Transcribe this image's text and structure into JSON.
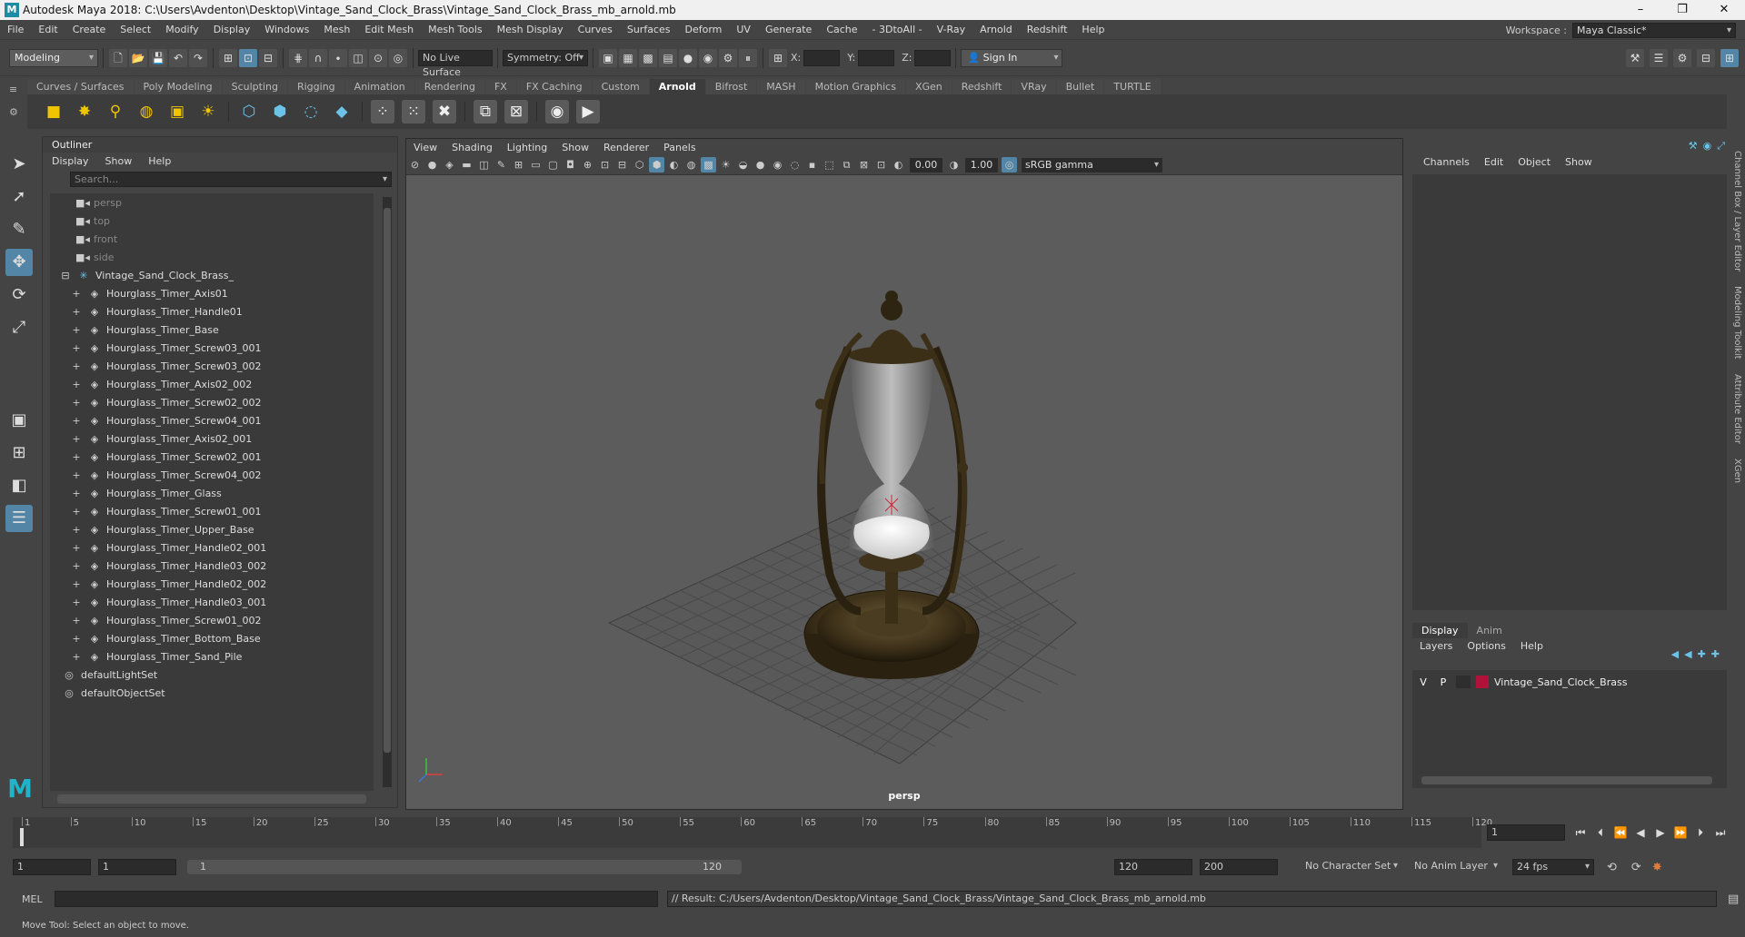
{
  "window": {
    "title": "Autodesk Maya 2018: C:\\Users\\Avdenton\\Desktop\\Vintage_Sand_Clock_Brass\\Vintage_Sand_Clock_Brass_mb_arnold.mb",
    "minimize": "–",
    "maximize": "❐",
    "close": "✕"
  },
  "menubar": {
    "items": [
      "File",
      "Edit",
      "Create",
      "Select",
      "Modify",
      "Display",
      "Windows",
      "Mesh",
      "Edit Mesh",
      "Mesh Tools",
      "Mesh Display",
      "Curves",
      "Surfaces",
      "Deform",
      "UV",
      "Generate",
      "Cache",
      "- 3DtoAll -",
      "V-Ray",
      "Arnold",
      "Redshift",
      "Help"
    ],
    "workspace_label": "Workspace :",
    "workspace_value": "Maya Classic*"
  },
  "statusline": {
    "menuset": "Modeling",
    "live_surface": "No Live Surface",
    "symmetry": "Symmetry: Off",
    "x_label": "X:",
    "y_label": "Y:",
    "z_label": "Z:",
    "sign_in": "Sign In"
  },
  "shelf": {
    "tabs": [
      "Curves / Surfaces",
      "Poly Modeling",
      "Sculpting",
      "Rigging",
      "Animation",
      "Rendering",
      "FX",
      "FX Caching",
      "Custom",
      "Arnold",
      "Bifrost",
      "MASH",
      "Motion Graphics",
      "XGen",
      "Redshift",
      "VRay",
      "Bullet",
      "TURTLE"
    ],
    "active_tab": "Arnold"
  },
  "outliner": {
    "title": "Outliner",
    "menu": [
      "Display",
      "Show",
      "Help"
    ],
    "search_placeholder": "Search...",
    "cameras": [
      "persp",
      "top",
      "front",
      "side"
    ],
    "group": "Vintage_Sand_Clock_Brass_",
    "children": [
      "Hourglass_Timer_Axis01",
      "Hourglass_Timer_Handle01",
      "Hourglass_Timer_Base",
      "Hourglass_Timer_Screw03_001",
      "Hourglass_Timer_Screw03_002",
      "Hourglass_Timer_Axis02_002",
      "Hourglass_Timer_Screw02_002",
      "Hourglass_Timer_Screw04_001",
      "Hourglass_Timer_Axis02_001",
      "Hourglass_Timer_Screw02_001",
      "Hourglass_Timer_Screw04_002",
      "Hourglass_Timer_Glass",
      "Hourglass_Timer_Screw01_001",
      "Hourglass_Timer_Upper_Base",
      "Hourglass_Timer_Handle02_001",
      "Hourglass_Timer_Handle03_002",
      "Hourglass_Timer_Handle02_002",
      "Hourglass_Timer_Handle03_001",
      "Hourglass_Timer_Screw01_002",
      "Hourglass_Timer_Bottom_Base",
      "Hourglass_Timer_Sand_Pile"
    ],
    "sets": [
      "defaultLightSet",
      "defaultObjectSet"
    ]
  },
  "viewport": {
    "menu": [
      "View",
      "Shading",
      "Lighting",
      "Show",
      "Renderer",
      "Panels"
    ],
    "exposure": "0.00",
    "gamma": "1.00",
    "colorspace": "sRGB gamma",
    "camera_label": "persp"
  },
  "channelbox": {
    "menu": [
      "Channels",
      "Edit",
      "Object",
      "Show"
    ],
    "layer_tabs": [
      "Display",
      "Anim"
    ],
    "layer_menu": [
      "Layers",
      "Options",
      "Help"
    ],
    "layer": {
      "v": "V",
      "p": "P",
      "name": "Vintage_Sand_Clock_Brass",
      "color": "#b1123a"
    },
    "side_tabs": [
      "Channel Box / Layer Editor",
      "Modeling Toolkit",
      "Attribute Editor",
      "XGen"
    ]
  },
  "timeline": {
    "ticks": [
      "1",
      "5",
      "10",
      "15",
      "20",
      "25",
      "30",
      "35",
      "40",
      "45",
      "50",
      "55",
      "60",
      "65",
      "70",
      "75",
      "80",
      "85",
      "90",
      "95",
      "100",
      "105",
      "110",
      "115",
      "120"
    ],
    "current_frame": "1",
    "range_start": "1",
    "range_inner_start": "1",
    "range_slider_start": "1",
    "range_slider_end": "120",
    "range_end": "120",
    "anim_end": "200",
    "character_set": "No Character Set",
    "anim_layer": "No Anim Layer",
    "fps": "24 fps"
  },
  "command": {
    "lang": "MEL",
    "result": "// Result: C:/Users/Avdenton/Desktop/Vintage_Sand_Clock_Brass/Vintage_Sand_Clock_Brass_mb_arnold.mb"
  },
  "helpline": {
    "text": "Move Tool: Select an object to move."
  }
}
